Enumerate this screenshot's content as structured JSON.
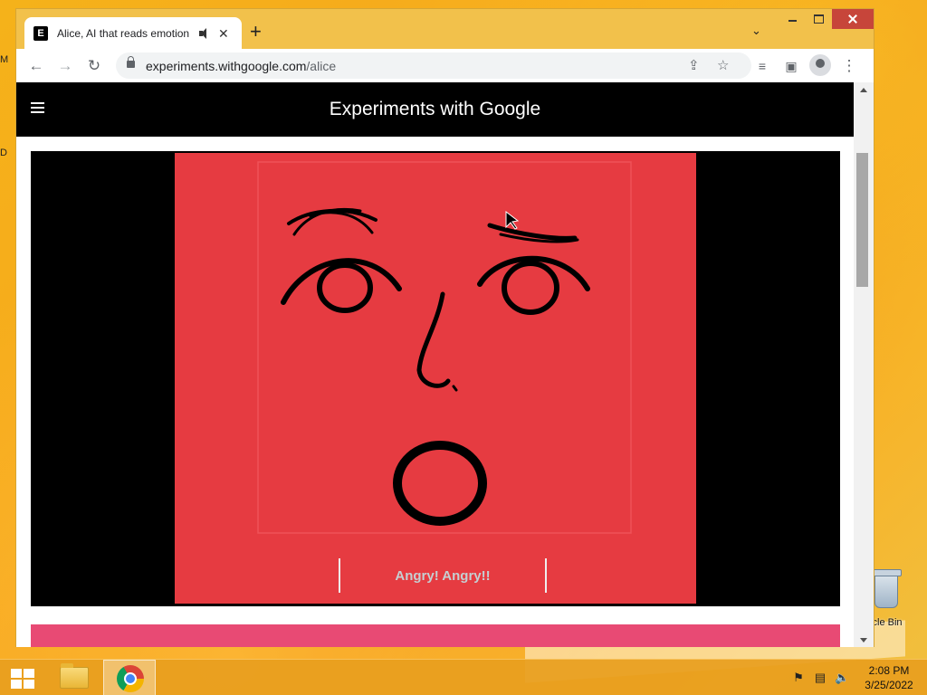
{
  "browser": {
    "tab_title": "Alice, AI that reads emotion",
    "favicon_letter": "E",
    "new_tab_symbol": "+",
    "url_host": "experiments.withgoogle.com",
    "url_path": "/alice",
    "icons": [
      "back-arrow-icon",
      "forward-arrow-icon",
      "reload-icon",
      "lock-icon",
      "share-icon",
      "bookmark-star-icon",
      "reading-list-icon",
      "side-panel-icon",
      "profile-icon",
      "menu-kebab-icon"
    ]
  },
  "site": {
    "title": "Experiments with Google",
    "video_caption": "Angry! Angry!!"
  },
  "taskbar": {
    "time": "2:08 PM",
    "date": "3/25/2022",
    "apps": [
      "file-explorer",
      "chrome"
    ]
  },
  "desktop": {
    "recycle_label": "ycle Bin",
    "left_icon_1": "M",
    "left_icon_2": "D"
  },
  "colors": {
    "face_bg": "#e63b41",
    "close_button": "#c7453a",
    "pink_bar": "#e84a74"
  }
}
